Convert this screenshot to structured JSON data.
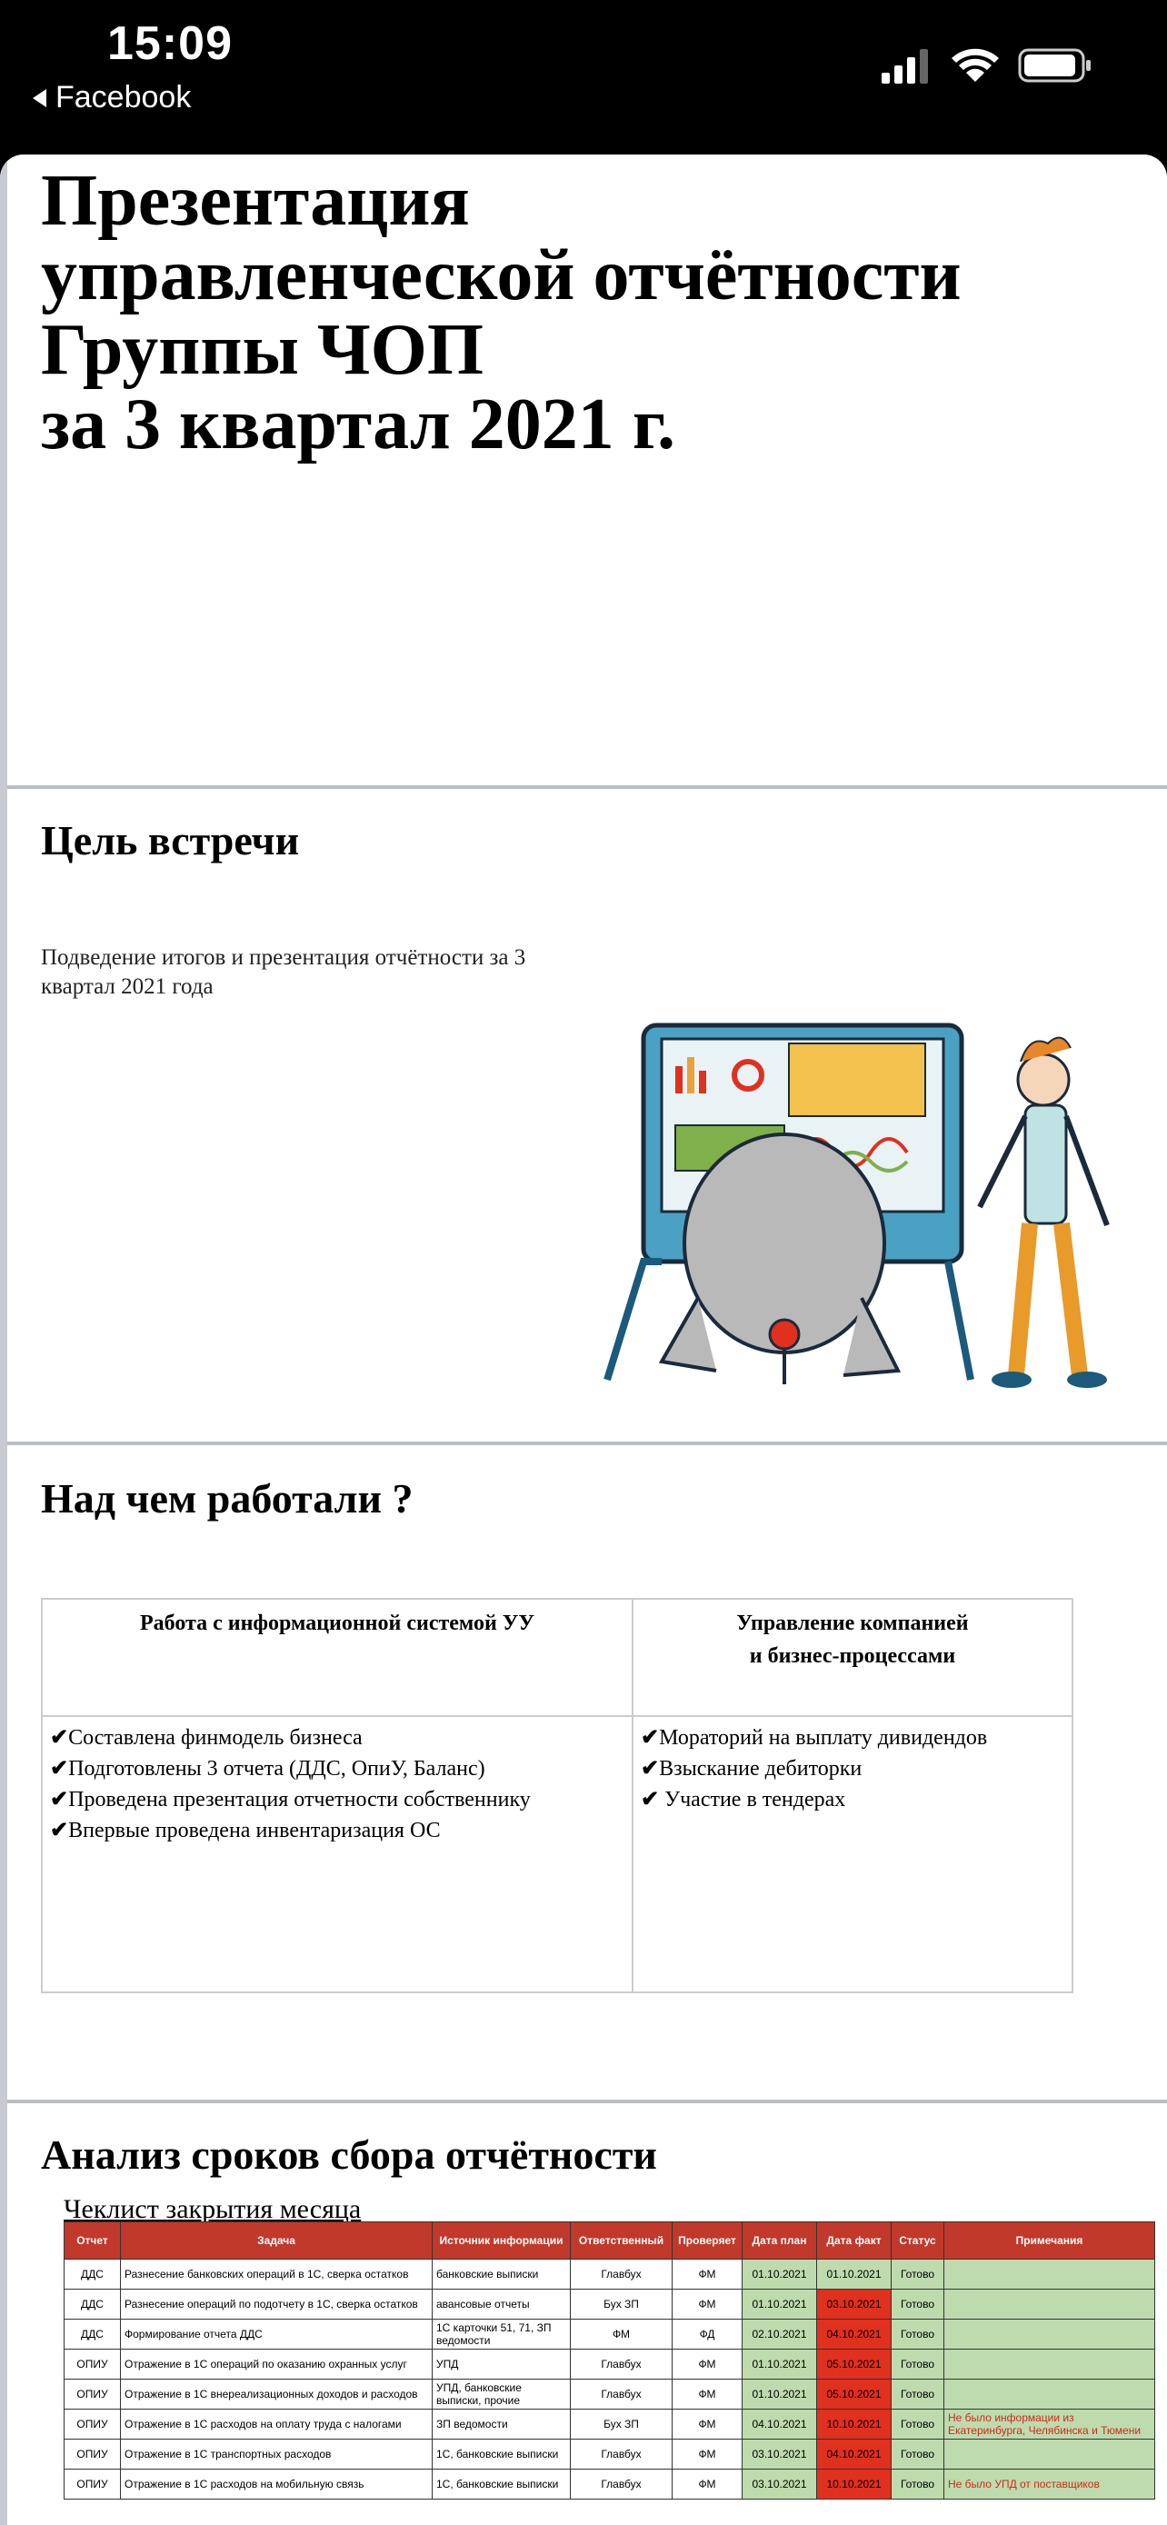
{
  "status_bar": {
    "time": "15:09",
    "back_label": "Facebook"
  },
  "slide1": {
    "title_lines": [
      "Презентация",
      "управленческой отчётности",
      "Группы ЧОП",
      "за 3 квартал 2021 г."
    ]
  },
  "slide2": {
    "heading": "Цель встречи",
    "text": "Подведение итогов и презентация отчётности за 3 квартал 2021 года"
  },
  "slide3": {
    "heading": "Над чем работали ?",
    "col1_header": "Работа с информационной системой УУ",
    "col2_header_lines": [
      "Управление компанией",
      "и бизнес-процессами"
    ],
    "col1_items": [
      "Составлена финмодель бизнеса",
      "Подготовлены 3 отчета (ДДС, ОпиУ, Баланс)",
      "Проведена презентация отчетности собственнику",
      "Впервые проведена инвентаризация ОС"
    ],
    "col2_items": [
      "Мораторий на выплату дивидендов",
      "Взыскание дебиторки",
      " Участие в тендерах"
    ]
  },
  "slide4": {
    "heading": "Анализ сроков сбора отчётности",
    "link": "Чеклист закрытия месяца",
    "table_headers": [
      "Отчет",
      "Задача",
      "Источник информации",
      "Ответственный",
      "Проверяет",
      "Дата план",
      "Дата факт",
      "Статус",
      "Примечания"
    ],
    "rows": [
      [
        "ДДС",
        "Разнесение банковских операций в 1С, сверка остатков",
        "банковские выписки",
        "Главбух",
        "ФМ",
        "01.10.2021",
        "01.10.2021",
        "Готово",
        ""
      ],
      [
        "ДДС",
        "Разнесение операций по подотчету в 1С, сверка остатков",
        "авансовые отчеты",
        "Бух ЗП",
        "ФМ",
        "01.10.2021",
        "03.10.2021",
        "Готово",
        ""
      ],
      [
        "ДДС",
        "Формирование отчета ДДС",
        "1С карточки 51, 71, ЗП ведомости",
        "ФМ",
        "ФД",
        "02.10.2021",
        "04.10.2021",
        "Готово",
        ""
      ],
      [
        "ОПИУ",
        "Отражение в 1С операций по оказанию охранных услуг",
        "УПД",
        "Главбух",
        "ФМ",
        "01.10.2021",
        "05.10.2021",
        "Готово",
        ""
      ],
      [
        "ОПИУ",
        "Отражение в 1С внереализационных доходов и расходов",
        "УПД, банковские выписки, прочие",
        "Главбух",
        "ФМ",
        "01.10.2021",
        "05.10.2021",
        "Готово",
        ""
      ],
      [
        "ОПИУ",
        "Отражение в 1С расходов на оплату труда с налогами",
        "ЗП ведомости",
        "Бух ЗП",
        "ФМ",
        "04.10.2021",
        "10.10.2021",
        "Готово",
        "Не было информации из Екатеринбурга, Челябинска и Тюмени"
      ],
      [
        "ОПИУ",
        "Отражение в 1С транспортных расходов",
        "1С, банковские выписки",
        "Главбух",
        "ФМ",
        "03.10.2021",
        "04.10.2021",
        "Готово",
        ""
      ],
      [
        "ОПИУ",
        "Отражение в 1С расходов на мобильную связь",
        "1С, банковские выписки",
        "Главбух",
        "ФМ",
        "03.10.2021",
        "10.10.2021",
        "Готово",
        "Не было УПД от поставщиков"
      ]
    ],
    "fact_colors": [
      "green",
      "red",
      "red",
      "red",
      "red",
      "red",
      "red",
      "red"
    ]
  }
}
